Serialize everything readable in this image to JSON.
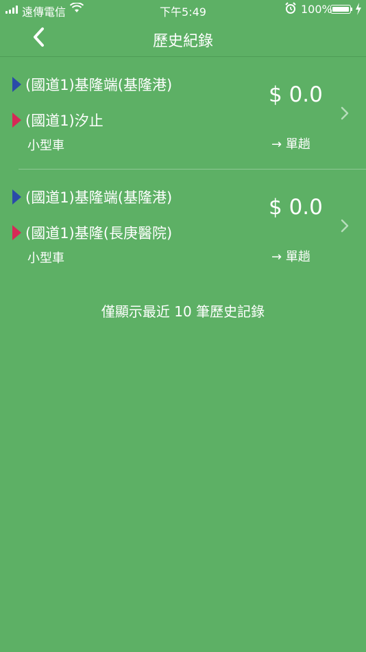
{
  "status_bar": {
    "carrier": "遠傳電信",
    "time": "下午5:49",
    "battery_percent": "100%",
    "battery_level": 1.0,
    "icons": [
      "signal-icon",
      "wifi-icon",
      "alarm-icon",
      "battery-icon",
      "charging-icon"
    ]
  },
  "nav": {
    "title": "歷史紀錄",
    "back_icon": "chevron-left-icon"
  },
  "records": [
    {
      "from": "(國道1)基隆端(基隆港)",
      "to": "(國道1)汐止",
      "vehicle": "小型車",
      "price": "$ 0.0",
      "trip": "→ 單趟"
    },
    {
      "from": "(國道1)基隆端(基隆港)",
      "to": "(國道1)基隆(長庚醫院)",
      "vehicle": "小型車",
      "price": "$ 0.0",
      "trip": "→ 單趟"
    }
  ],
  "footer_note": "僅顯示最近 10 筆歷史記錄",
  "colors": {
    "background": "#5DB065",
    "text": "#FFFFFF",
    "from_marker": "#2A4BA8",
    "to_marker": "#D72856",
    "chevron": "#B7DDBB"
  }
}
